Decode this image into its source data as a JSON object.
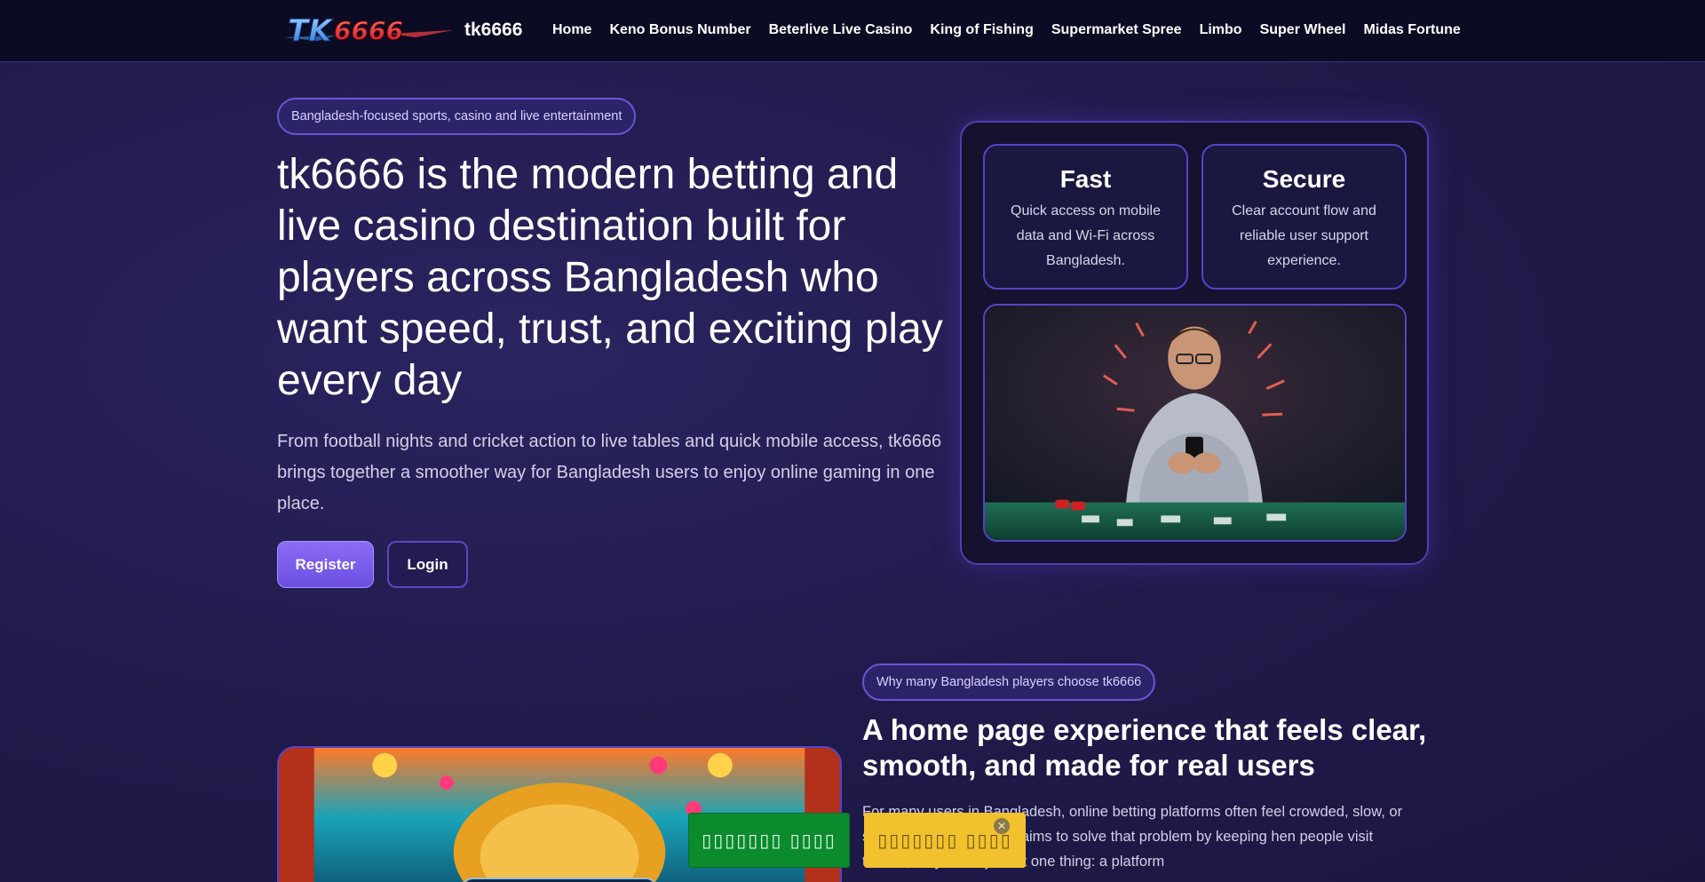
{
  "header": {
    "brand": "tk6666",
    "logo_text": "TK6666",
    "nav": [
      "Home",
      "Keno Bonus Number",
      "Beterlive Live Casino",
      "King of Fishing",
      "Supermarket Spree",
      "Limbo",
      "Super Wheel",
      "Midas Fortune"
    ]
  },
  "hero": {
    "pill": "Bangladesh-focused sports, casino and live entertainment",
    "title": "tk6666 is the modern betting and live casino destination built for players across Bangladesh who want speed, trust, and exciting play every day",
    "subtitle": "From football nights and cricket action to live tables and quick mobile access, tk6666 brings together a smoother way for Bangladesh users to enjoy online gaming in one place.",
    "register_label": "Register",
    "login_label": "Login"
  },
  "features": [
    {
      "title": "Fast",
      "text": "Quick access on mobile data and Wi-Fi across Bangladesh."
    },
    {
      "title": "Secure",
      "text": "Clear account flow and reliable user support experience."
    }
  ],
  "section2": {
    "pill": "Why many Bangladesh players choose tk6666",
    "title": "A home page experience that feels clear, smooth, and made for real users",
    "body": "For many users in Bangladesh, online betting platforms often feel crowded, slow, or smaller screens. tk6666 aims to solve that problem by keeping hen people visit tk6666, they usually want one thing: a platform"
  },
  "floating": {
    "green_label": "▯▯▯▯▯▯▯ ▯▯▯▯",
    "yellow_label": "▯▯▯▯▯▯▯ ▯▯▯▯",
    "close": "✕"
  },
  "colors": {
    "accent": "#7c5cf0",
    "background": "#221d4f",
    "header": "#0b0b24",
    "green": "#0b8a2e",
    "yellow": "#f2c12e"
  }
}
